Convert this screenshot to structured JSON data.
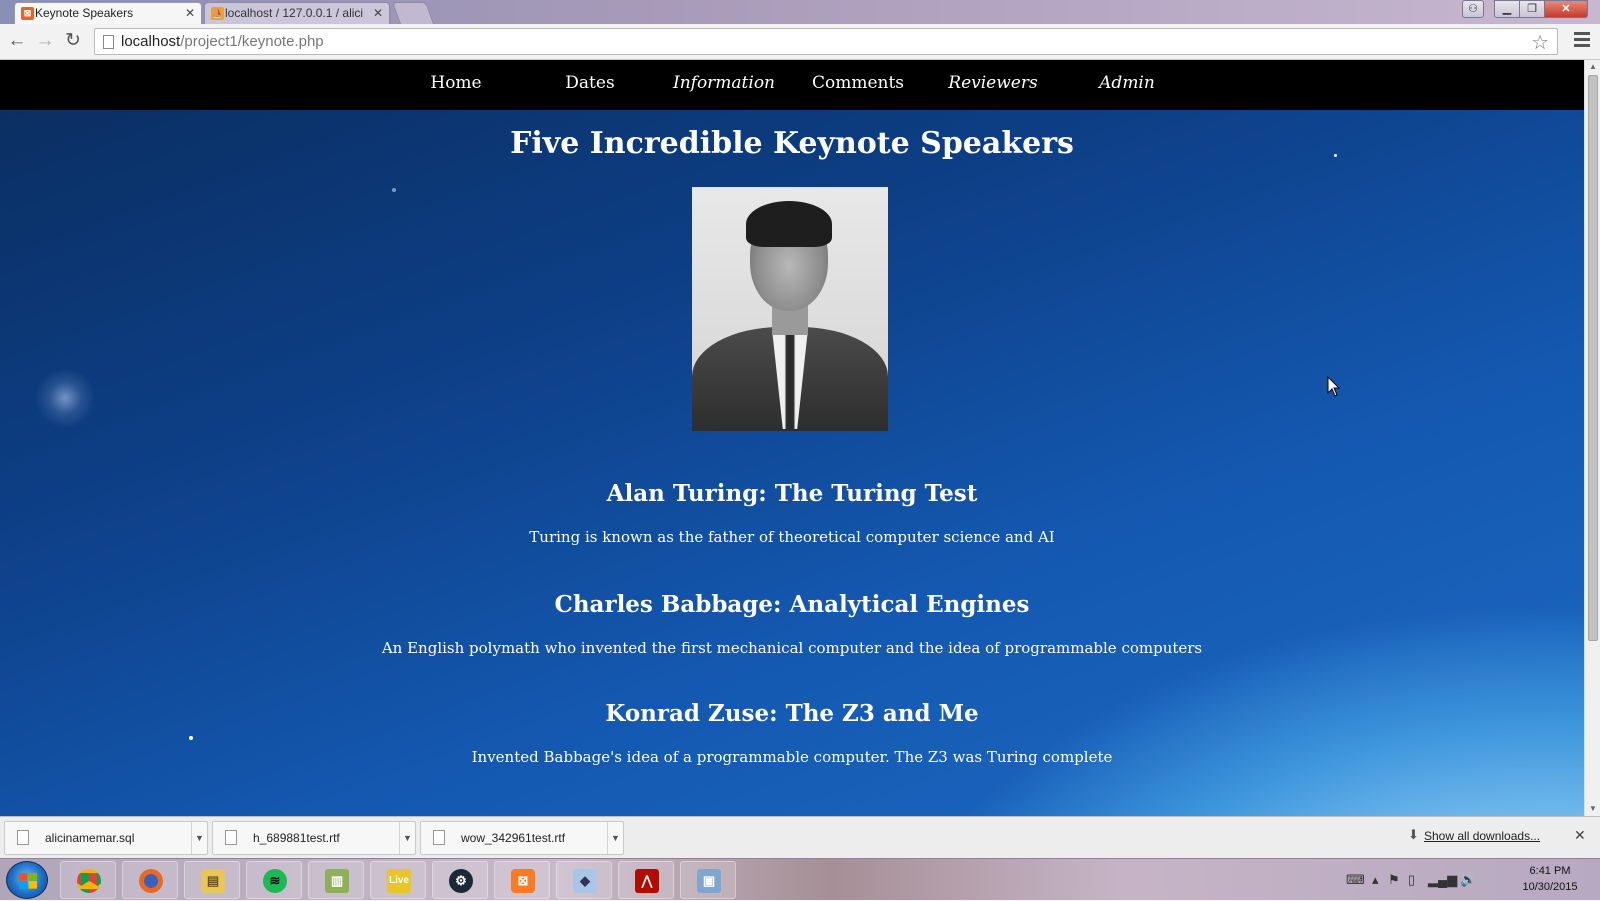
{
  "browser": {
    "tabs": [
      {
        "title": "Keynote Speakers",
        "active": true
      },
      {
        "title": "localhost / 127.0.0.1 / alici",
        "active": false
      }
    ],
    "url_host": "localhost",
    "url_path": "/project1/keynote.php"
  },
  "site": {
    "nav": [
      {
        "label": "Home",
        "italic": false
      },
      {
        "label": "Dates",
        "italic": false
      },
      {
        "label": "Information",
        "italic": true
      },
      {
        "label": "Comments",
        "italic": false
      },
      {
        "label": "Reviewers",
        "italic": true
      },
      {
        "label": "Admin",
        "italic": true
      }
    ],
    "heading": "Five Incredible Keynote Speakers",
    "speakers": [
      {
        "title": "Alan Turing: The Turing Test",
        "description": "Turing is known as the father of theoretical computer science and AI"
      },
      {
        "title": "Charles Babbage: Analytical Engines",
        "description": "An English polymath who invented the first mechanical computer and the idea of programmable computers"
      },
      {
        "title": "Konrad Zuse: The Z3 and Me",
        "description": "Invented Babbage's idea of a programmable computer. The Z3 was Turing complete"
      }
    ]
  },
  "downloads": {
    "items": [
      "alicinamemar.sql",
      "h_689881test.rtf",
      "wow_342961test.rtf"
    ],
    "show_all": "Show all downloads..."
  },
  "taskbar": {
    "apps": [
      "chrome",
      "firefox",
      "file-explorer",
      "spotify",
      "spreadsheet",
      "live",
      "steam",
      "xampp",
      "virtualbox",
      "acrobat",
      "remote-desktop"
    ],
    "time": "6:41 PM",
    "date": "10/30/2015"
  }
}
